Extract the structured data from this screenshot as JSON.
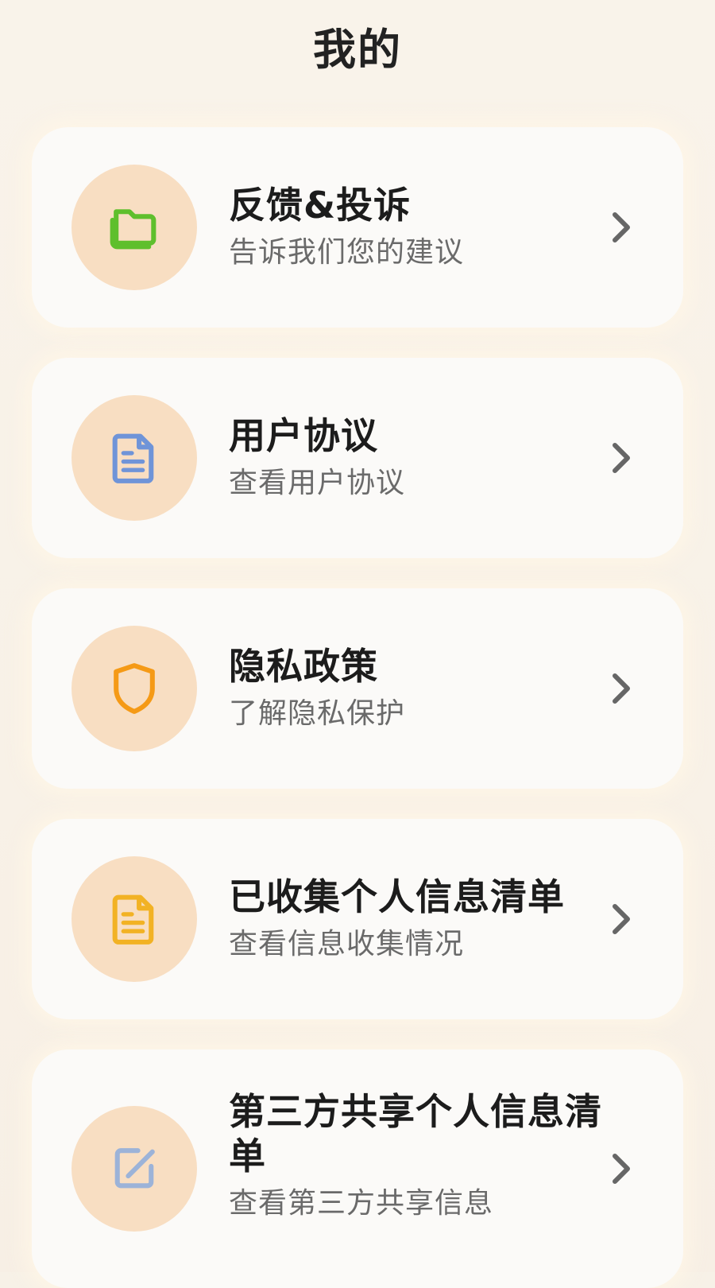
{
  "header": {
    "title": "我的"
  },
  "menu": {
    "items": [
      {
        "title": "反馈&投诉",
        "subtitle": "告诉我们您的建议",
        "icon": "folder-icon",
        "icon_color": "#5fbf2d"
      },
      {
        "title": "用户协议",
        "subtitle": "查看用户协议",
        "icon": "document-icon",
        "icon_color": "#6f94d8"
      },
      {
        "title": "隐私政策",
        "subtitle": "了解隐私保护",
        "icon": "shield-icon",
        "icon_color": "#f59a16"
      },
      {
        "title": "已收集个人信息清单",
        "subtitle": "查看信息收集情况",
        "icon": "document-icon",
        "icon_color": "#f2b224"
      },
      {
        "title": "第三方共享个人信息清单",
        "subtitle": "查看第三方共享信息",
        "icon": "edit-icon",
        "icon_color": "#9cb3d8"
      }
    ]
  },
  "colors": {
    "background": "#f7f1e7",
    "card": "#fbfaf8",
    "icon_circle": "#f8dec2",
    "title_text": "#1c1c1c",
    "subtitle_text": "#6a6a6a",
    "chevron": "#666666"
  }
}
